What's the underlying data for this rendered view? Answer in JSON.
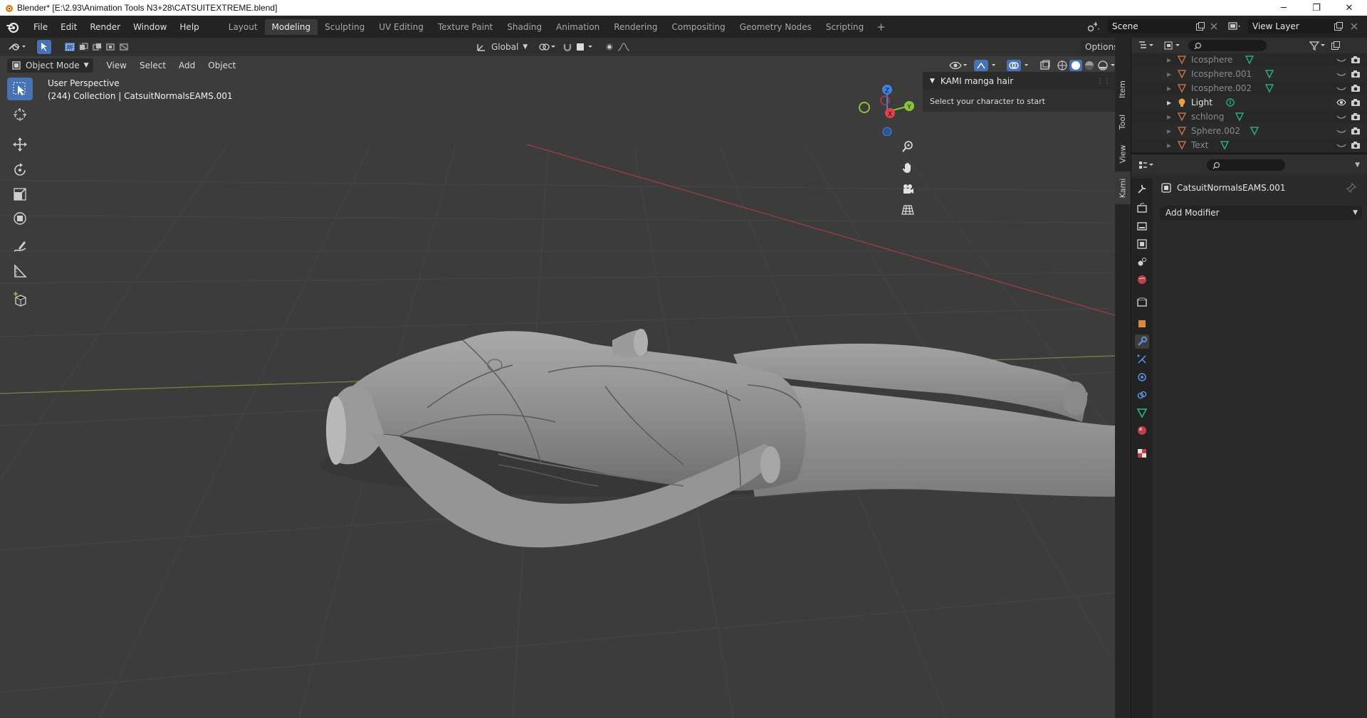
{
  "window": {
    "title": "Blender* [E:\\2.93\\Animation Tools N3+28\\CATSUITEXTREME.blend]",
    "minimize": "─",
    "maximize": "❐",
    "close": "✕"
  },
  "menubar": {
    "items": [
      "File",
      "Edit",
      "Render",
      "Window",
      "Help"
    ]
  },
  "workspaces": {
    "tabs": [
      "Layout",
      "Modeling",
      "Sculpting",
      "UV Editing",
      "Texture Paint",
      "Shading",
      "Animation",
      "Rendering",
      "Compositing",
      "Geometry Nodes",
      "Scripting"
    ],
    "active": "Modeling",
    "add": "+"
  },
  "scene": {
    "label": "Scene"
  },
  "view_layer": {
    "label": "View Layer"
  },
  "viewport": {
    "transform_orientation": "Global",
    "options_label": "Options",
    "mode": "Object Mode",
    "menus": [
      "View",
      "Select",
      "Add",
      "Object"
    ],
    "perspective_label": "User Perspective",
    "collection_info": "(244) Collection | CatsuitNormalsEAMS.001",
    "gizmo": {
      "x": "X",
      "y": "Y",
      "z": "Z"
    }
  },
  "npanel": {
    "header": "KAMI manga hair",
    "body": "Select your character to start",
    "tabs": [
      "Item",
      "Tool",
      "View",
      "Kami"
    ],
    "active_tab": "Kami"
  },
  "outliner": {
    "rows": [
      {
        "name": "Icosphere",
        "dim": true,
        "icon_color": "#d9884a"
      },
      {
        "name": "Icosphere.001",
        "dim": true,
        "icon_color": "#d9884a"
      },
      {
        "name": "Icosphere.002",
        "dim": true,
        "icon_color": "#d9884a"
      },
      {
        "name": "Light",
        "dim": false,
        "icon_color": "#e8a040"
      },
      {
        "name": "schlong",
        "dim": true,
        "icon_color": "#d9884a"
      },
      {
        "name": "Sphere.002",
        "dim": true,
        "icon_color": "#d9884a"
      },
      {
        "name": "Text",
        "dim": true,
        "icon_color": "#d9884a"
      }
    ]
  },
  "properties": {
    "object_name": "CatsuitNormalsEAMS.001",
    "add_modifier": "Add Modifier"
  },
  "colors": {
    "accent": "#4772b3",
    "x_axis": "#e0424a",
    "y_axis": "#8ac43a",
    "z_axis": "#3f82e0"
  }
}
